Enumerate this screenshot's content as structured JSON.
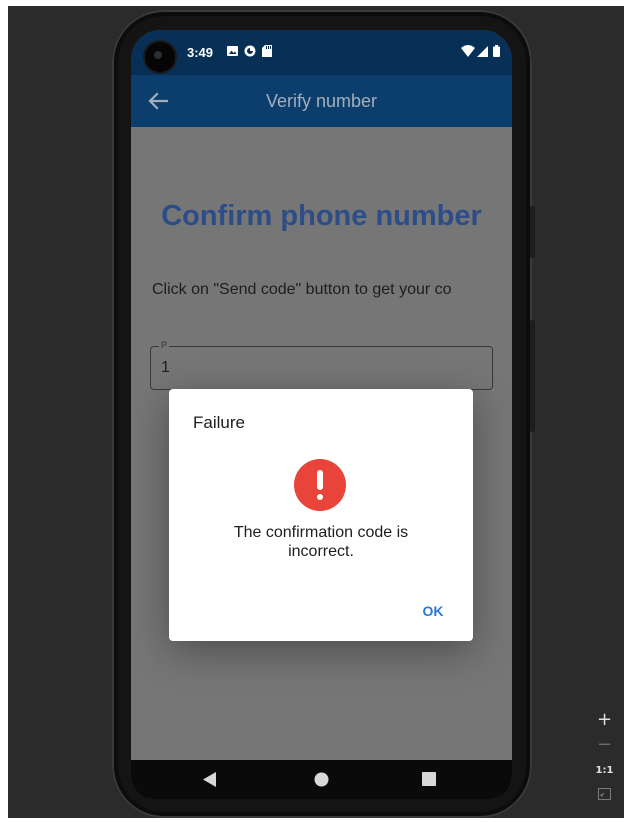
{
  "status_bar": {
    "time": "3:49"
  },
  "app_bar": {
    "title": "Verify number"
  },
  "page": {
    "heading": "Confirm phone number",
    "instruction": "Click on \"Send code\" button to get your co",
    "field_label": "P",
    "field_value": "1"
  },
  "dialog": {
    "title": "Failure",
    "message": "The confirmation code is incorrect.",
    "ok_label": "OK",
    "icon": "error-icon"
  },
  "zoom_controls": {
    "zoom_in": "+",
    "zoom_out": "−",
    "actual_size": "1:1"
  },
  "colors": {
    "status_bar": "#082f55",
    "app_bar": "#0b3e6c",
    "heading": "#2c4d87",
    "error": "#e8443a",
    "ok_button": "#2a7bd2"
  }
}
